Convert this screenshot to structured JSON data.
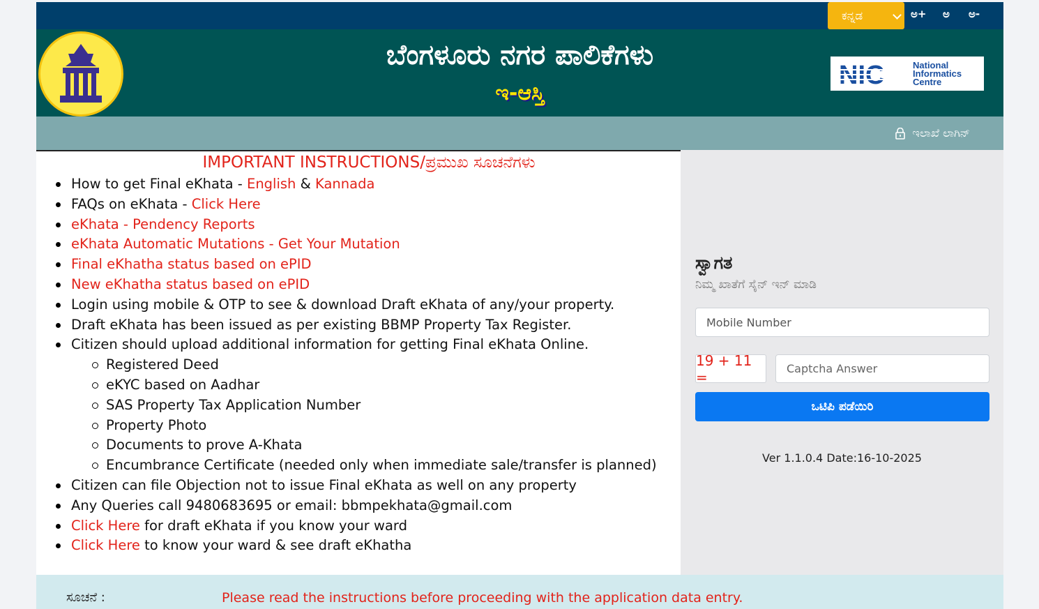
{
  "topbar": {
    "language": "ಕನ್ನಡ",
    "font_increase": "ಅ+",
    "font_normal": "ಅ",
    "font_decrease": "ಅ-"
  },
  "header": {
    "title": "ಬೆಂಗಳೂರು ನಗರ ಪಾಲಿಕೆಗಳು",
    "subtitle": "ಇ-ಆಸ್ತಿ",
    "nic_line1": "National",
    "nic_line2": "Informatics",
    "nic_line3": "Centre",
    "nic_abbr": "NIC"
  },
  "subbar": {
    "login_label": "ಇಲಾಖೆ ಲಾಗಿನ್"
  },
  "instructions": {
    "title": "IMPORTANT INSTRUCTIONS/ಪ್ರಮುಖ ಸೂಚನೆಗಳು",
    "item1_prefix": "How to get Final eKhata - ",
    "item1_link1": "English",
    "item1_amp": " & ",
    "item1_link2": "Kannada",
    "item2_prefix": "FAQs on eKhata - ",
    "item2_link": "Click Here",
    "item3": "eKhata - Pendency Reports",
    "item4": "eKhata Automatic Mutations - Get Your Mutation",
    "item5": "Final eKhatha status based on ePID",
    "item6": "New eKhatha status based on ePID",
    "item7": "Login using mobile & OTP to see & download Draft eKhata of any/your property.",
    "item8": "Draft eKhata has been issued as per existing BBMP Property Tax Register.",
    "item9": "Citizen should upload additional information for getting Final eKhata Online.",
    "sub": [
      "Registered Deed",
      "eKYC based on Aadhar",
      "SAS Property Tax Application Number",
      "Property Photo",
      "Documents to prove A-Khata",
      "Encumbrance Certificate (needed only when immediate sale/transfer is planned)"
    ],
    "item10": "Citizen can file Objection not to issue Final eKhata as well on any property",
    "item11": "Any Queries call 9480683695 or email: bbmpekhata@gmail.com",
    "item12_link": "Click Here",
    "item12_rest": " for draft eKhata if you know your ward",
    "item13_link": "Click Here",
    "item13_rest": " to know your ward & see draft eKhatha"
  },
  "login": {
    "welcome": "ಸ್ವಾಗತ",
    "welcome_sub": "ನಿಮ್ಮ ಖಾತೆಗೆ ಸೈನ್ ಇನ್ ಮಾಡಿ",
    "mobile_placeholder": "Mobile Number",
    "captcha": "19 + 11 =",
    "captcha_placeholder": "Captcha Answer",
    "otp_button": "ಒಟಿಪಿ ಪಡೆಯಿರಿ",
    "version": "Ver 1.1.0.4 Date:16-10-2025"
  },
  "notice": {
    "label": "ಸೂಚನೆ :",
    "text": "Please read the instructions before proceeding with the application data entry."
  },
  "colors": {
    "topbar": "#003f6b",
    "header": "#005454",
    "accent_red": "#e2231a",
    "button_blue": "#0a78f2",
    "lang_yellow": "#f5b50f"
  }
}
